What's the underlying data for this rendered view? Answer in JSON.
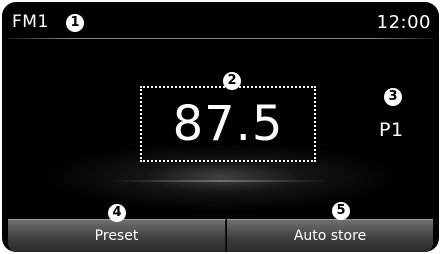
{
  "status_bar": {
    "band": "FM1",
    "clock": "12:00"
  },
  "tuner": {
    "frequency": "87.5",
    "preset": "P1"
  },
  "softkeys": {
    "preset_label": "Preset",
    "auto_store_label": "Auto store"
  },
  "callouts": [
    "1",
    "2",
    "3",
    "4",
    "5"
  ]
}
